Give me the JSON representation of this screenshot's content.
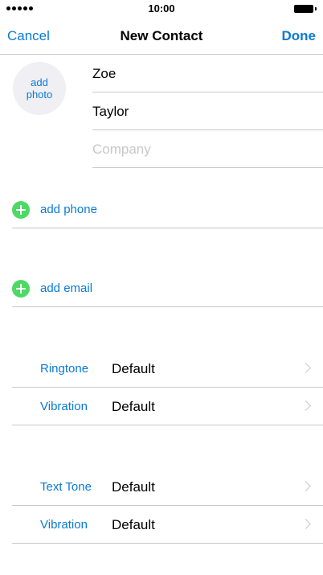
{
  "status_bar": {
    "time": "10:00",
    "signal_icon": "signal-dots-icon",
    "battery_icon": "battery-icon"
  },
  "nav": {
    "cancel_label": "Cancel",
    "title": "New Contact",
    "done_label": "Done"
  },
  "photo": {
    "line1": "add",
    "line2": "photo"
  },
  "fields": {
    "first_name": "Zoe",
    "last_name": "Taylor",
    "company_placeholder": "Company"
  },
  "add_phone": {
    "label": "add phone",
    "icon": "plus-circle-icon"
  },
  "add_email": {
    "label": "add email",
    "icon": "plus-circle-icon"
  },
  "call_settings": [
    {
      "label": "Ringtone",
      "value": "Default"
    },
    {
      "label": "Vibration",
      "value": "Default"
    }
  ],
  "text_settings": [
    {
      "label": "Text Tone",
      "value": "Default"
    },
    {
      "label": "Vibration",
      "value": "Default"
    }
  ],
  "colors": {
    "accent": "#0a7ad6",
    "add_green": "#4cd964",
    "separator": "#c8c7cc",
    "placeholder": "#c7c7cd"
  }
}
